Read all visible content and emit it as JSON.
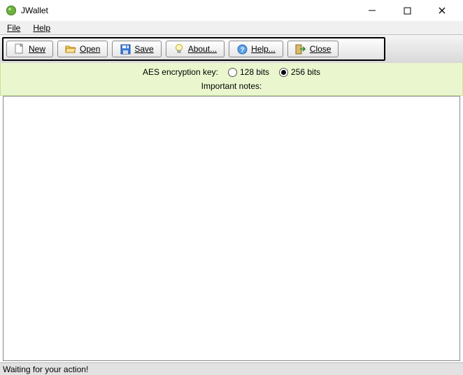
{
  "app": {
    "title": "JWallet"
  },
  "menus": {
    "file": "File",
    "help": "Help"
  },
  "toolbar": {
    "new": "New",
    "open": "Open",
    "save": "Save",
    "about": "About...",
    "help": "Help...",
    "close": "Close"
  },
  "encryption": {
    "label": "AES encryption key:",
    "opt128": "128 bits",
    "opt256": "256 bits",
    "selected": "256"
  },
  "notes": {
    "label": "Important notes:"
  },
  "status": {
    "text": "Waiting for your action!"
  }
}
